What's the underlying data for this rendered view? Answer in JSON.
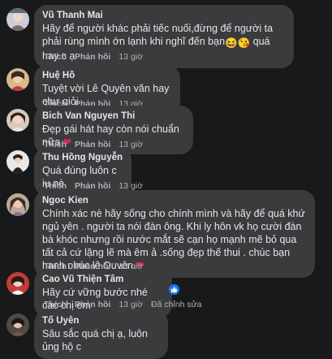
{
  "actions": {
    "like": "Thích",
    "reply": "Phản hồi"
  },
  "comments": [
    {
      "author": "Vũ Thanh Mai",
      "text": "Hãy để người khác phải tiếc nuối,đừng để người ta phải rùng mình ớn lạnh khi nghĩ đến bạn",
      "text_tail": "quá hay c ạ",
      "emojis": "😆😘",
      "time": "13 giờ"
    },
    {
      "author": "Huệ Hồ",
      "text": "Tuyệt vời Lê Quyên văn hay chư giỏi",
      "time": "13 giờ"
    },
    {
      "author": "Bich Van Nguyen Thi",
      "text": "Đẹp gái hát hay còn nói chuẩn nữa",
      "heart": "❤",
      "time": "13 giờ"
    },
    {
      "author": "Thu Hồng Nguyễn",
      "text": "Quá đúng luôn c iu nè",
      "time": "13 giờ"
    },
    {
      "author": "Ngoc Kien",
      "text": "Chính xác nè hãy sống cho chính mình và hãy để quá khứ ngủ yên . người ta nói đàn ông. Khi ly hôn vk họ cười đàn bà khóc nhưng rồi nước mắt sẽ cạn họ mạnh mẽ bỏ qua tất cả cứ lặng lẽ mà êm ả .sống đẹp thế thui . chúc bạn hạnh phúc lệ Quyên.",
      "heart": "❤",
      "time": "13 giờ"
    },
    {
      "author": "Cao Vũ Thiện Tâm",
      "text": "Hãy cứ vững bước nhé các chị em",
      "time": "13 giờ",
      "edited": "Đã chỉnh sửa"
    },
    {
      "author": "Tố Uyên",
      "text": "Sâu sắc quá chị ạ, luôn ủng hộ c"
    }
  ]
}
